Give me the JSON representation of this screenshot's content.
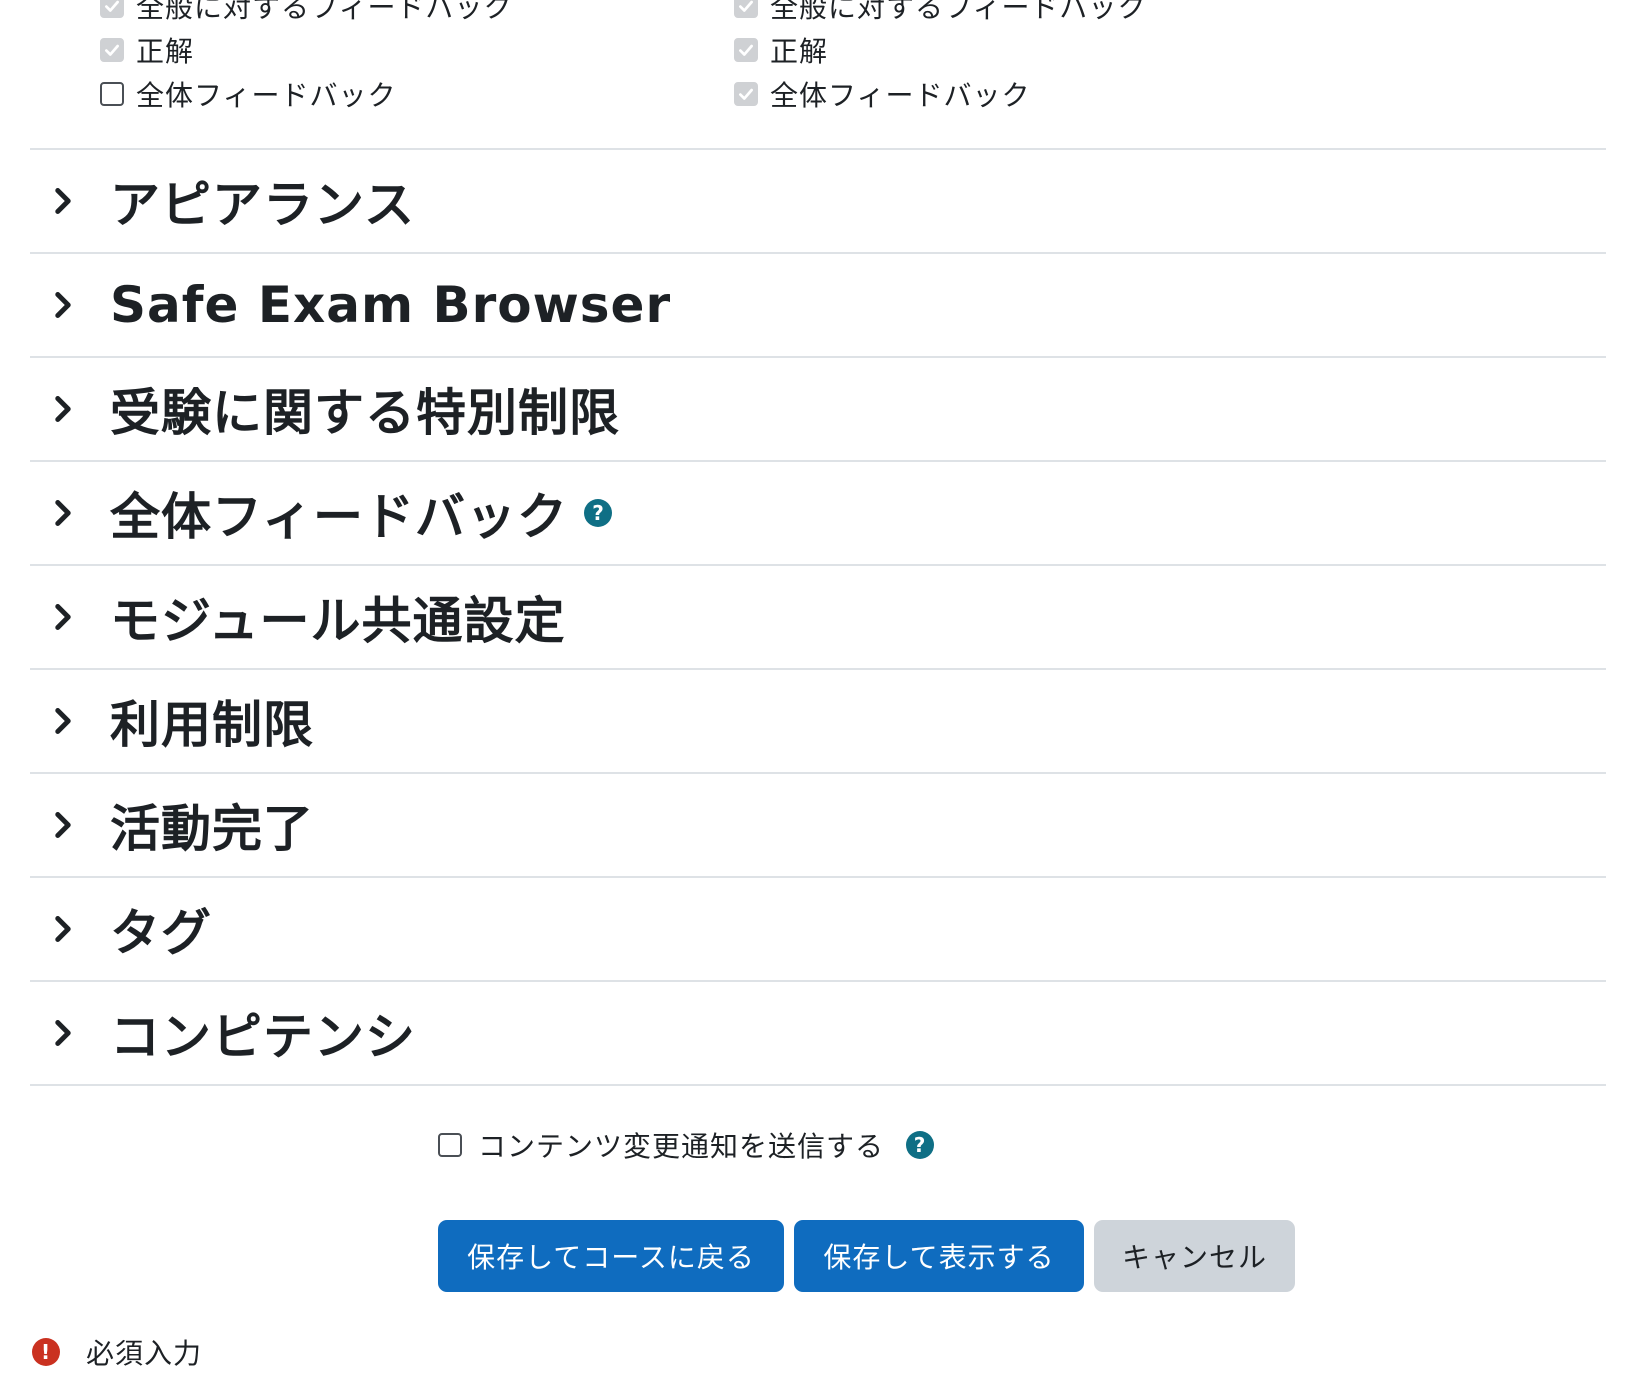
{
  "review_options": {
    "left_column": [
      {
        "label": "全般に対するフィードバック",
        "checked": true,
        "disabled": true
      },
      {
        "label": "正解",
        "checked": true,
        "disabled": true
      },
      {
        "label": "全体フィードバック",
        "checked": false,
        "disabled": false
      }
    ],
    "right_column": [
      {
        "label": "全般に対するフィードバック",
        "checked": true,
        "disabled": true
      },
      {
        "label": "正解",
        "checked": true,
        "disabled": true
      },
      {
        "label": "全体フィードバック",
        "checked": true,
        "disabled": true
      }
    ]
  },
  "sections": [
    {
      "title": "アピアランス",
      "expanded": false,
      "help": false
    },
    {
      "title": "Safe Exam Browser",
      "expanded": false,
      "help": false
    },
    {
      "title": "受験に関する特別制限",
      "expanded": false,
      "help": false
    },
    {
      "title": "全体フィードバック",
      "expanded": false,
      "help": true
    },
    {
      "title": "モジュール共通設定",
      "expanded": false,
      "help": false
    },
    {
      "title": "利用制限",
      "expanded": false,
      "help": false
    },
    {
      "title": "活動完了",
      "expanded": false,
      "help": false
    },
    {
      "title": "タグ",
      "expanded": false,
      "help": false
    },
    {
      "title": "コンピテンシ",
      "expanded": false,
      "help": false
    }
  ],
  "notify": {
    "label": "コンテンツ変更通知を送信する",
    "checked": false
  },
  "buttons": {
    "save_return": "保存してコースに戻る",
    "save_display": "保存して表示する",
    "cancel": "キャンセル"
  },
  "required_legend": "必須入力",
  "colors": {
    "primary_button": "#0f6cbf",
    "secondary_button": "#ced4da",
    "help_icon": "#0f6f85",
    "required_icon": "#ca3120",
    "divider": "#dee2e6"
  }
}
